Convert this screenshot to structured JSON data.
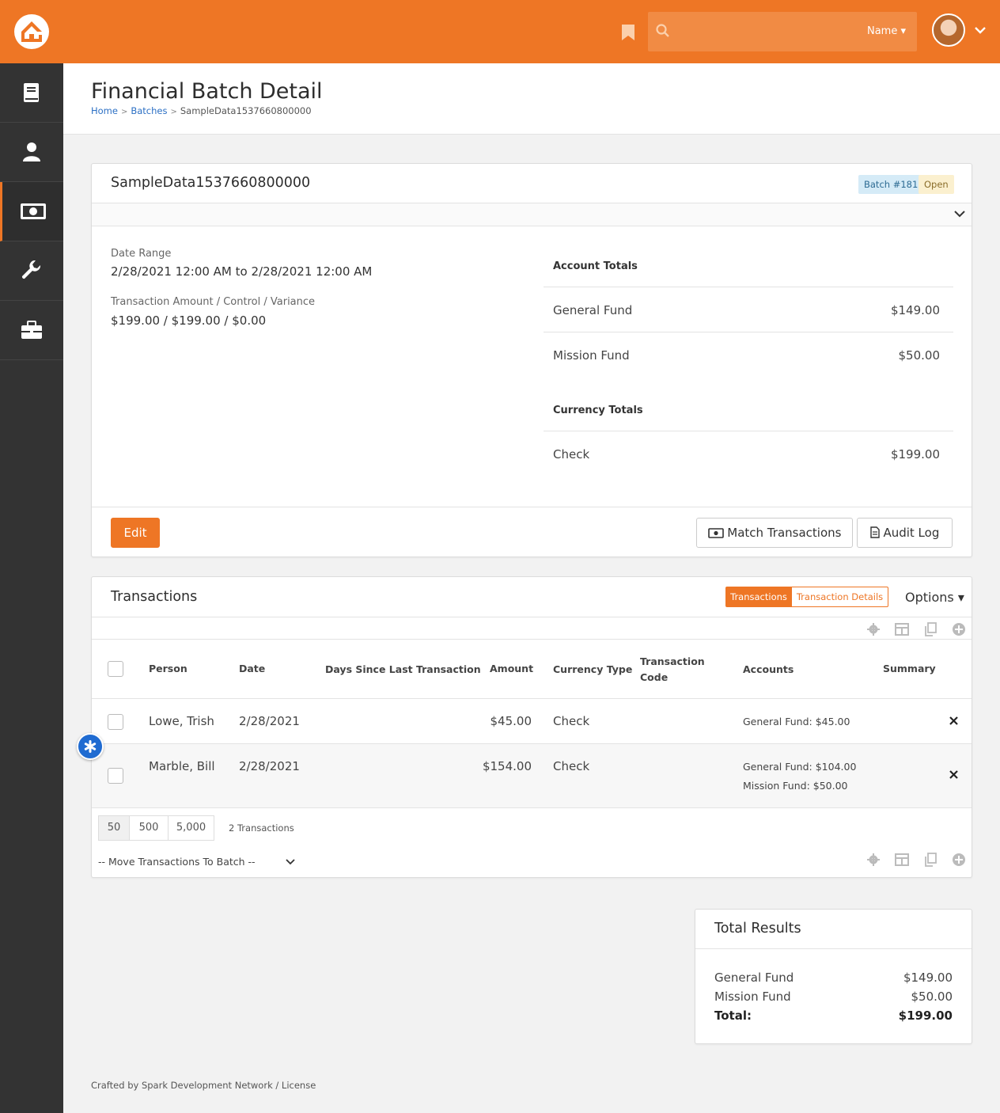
{
  "header": {
    "search_placeholder": "",
    "search_filter": "Name",
    "colors": {
      "brand": "#ee7625",
      "sidebar": "#333333"
    }
  },
  "sidebar": {
    "items": [
      {
        "icon": "book-icon"
      },
      {
        "icon": "person-icon"
      },
      {
        "icon": "money-icon",
        "active": true
      },
      {
        "icon": "wrench-icon"
      },
      {
        "icon": "briefcase-icon"
      }
    ]
  },
  "page": {
    "title": "Financial Batch Detail",
    "breadcrumbs": [
      "Home",
      "Batches",
      "SampleData1537660800000"
    ]
  },
  "batch": {
    "name": "SampleData1537660800000",
    "badge_batch": "Batch #181",
    "badge_status": "Open",
    "date_range_label": "Date Range",
    "date_range_value": "2/28/2021 12:00 AM to 2/28/2021 12:00 AM",
    "amount_label": "Transaction Amount / Control / Variance",
    "amount_value": "$199.00 / $199.00 / $0.00",
    "account_totals_label": "Account Totals",
    "account_totals": [
      {
        "name": "General Fund",
        "amount": "$149.00"
      },
      {
        "name": "Mission Fund",
        "amount": "$50.00"
      }
    ],
    "currency_totals_label": "Currency Totals",
    "currency_totals": [
      {
        "name": "Check",
        "amount": "$199.00"
      }
    ],
    "edit_label": "Edit",
    "match_label": "Match Transactions",
    "audit_label": "Audit Log"
  },
  "transactions": {
    "title": "Transactions",
    "toggle_active": "Transactions",
    "toggle_other": "Transaction Details",
    "options_label": "Options",
    "columns": [
      "Person",
      "Date",
      "Days Since Last Transaction",
      "Amount",
      "Currency Type",
      "Transaction",
      "Code",
      "Accounts",
      "Summary"
    ],
    "rows": [
      {
        "person": "Lowe, Trish",
        "date": "2/28/2021",
        "amount": "$45.00",
        "currency": "Check",
        "accounts": [
          "General Fund: $45.00"
        ]
      },
      {
        "person": "Marble, Bill",
        "date": "2/28/2021",
        "amount": "$154.00",
        "currency": "Check",
        "accounts": [
          "General Fund: $104.00",
          "Mission Fund: $50.00"
        ]
      }
    ],
    "page_sizes": [
      "50",
      "500",
      "5,000"
    ],
    "count_text": "2 Transactions",
    "move_placeholder": "-- Move Transactions To Batch --"
  },
  "total_results": {
    "title": "Total Results",
    "lines": [
      {
        "name": "General Fund",
        "amount": "$149.00"
      },
      {
        "name": "Mission Fund",
        "amount": "$50.00"
      }
    ],
    "total_label": "Total:",
    "total_amount": "$199.00"
  },
  "footer": {
    "text": "Crafted by Spark Development Network / License"
  }
}
